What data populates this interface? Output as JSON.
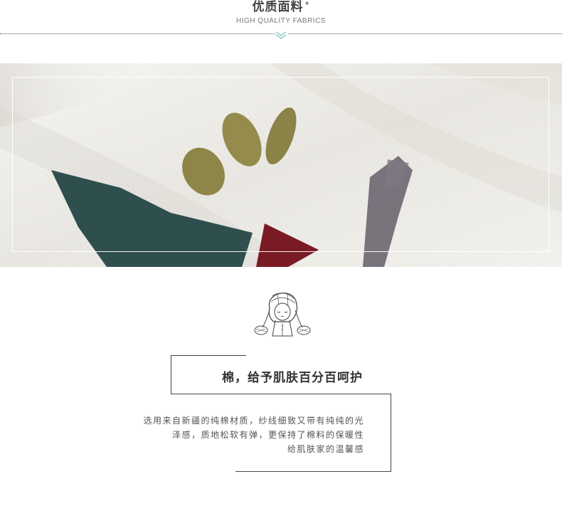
{
  "header": {
    "title_cn": "优质面料",
    "title_deg": "°",
    "title_en": "HIGH QUALITY FABRICS"
  },
  "icons": {
    "chevron": "double-chevron-down-icon",
    "girl": "girl-illustration-icon"
  },
  "colors": {
    "fabric": "#efede8",
    "olive": "#8e8549",
    "teal": "#2f4f4f",
    "maroon": "#7a1a24",
    "grey_stroke": "#6b6670",
    "chevron": "#8fc9c9"
  },
  "feature": {
    "headline": "棉，给予肌肤百分百呵护",
    "lines": [
      "选用来自新疆的纯棉材质，纱线细致又带有纯纯的光",
      "泽感，质地松软有弹，更保持了棉料的保暖性",
      "给肌肤家的温馨感"
    ]
  }
}
